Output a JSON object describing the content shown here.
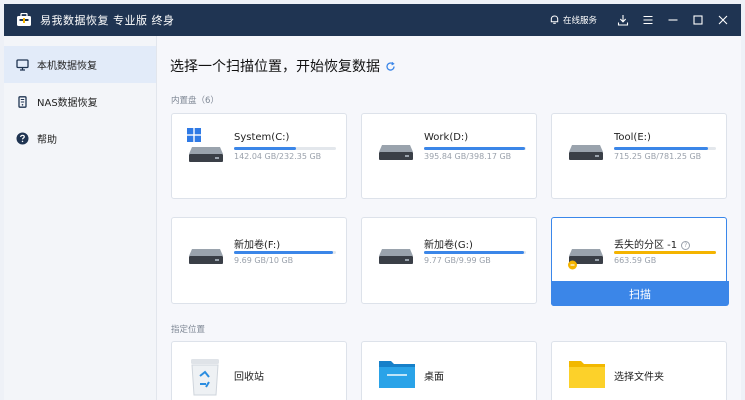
{
  "window": {
    "title": "易我数据恢复 专业版 终身",
    "online_service": "在线服务"
  },
  "sidebar": {
    "items": [
      {
        "label": "本机数据恢复",
        "icon": "computer-icon",
        "active": true
      },
      {
        "label": "NAS数据恢复",
        "icon": "nas-icon",
        "active": false
      },
      {
        "label": "帮助",
        "icon": "help-icon",
        "active": false
      }
    ]
  },
  "main": {
    "heading": "选择一个扫描位置，开始恢复数据",
    "internal_disks_label": "内置盘（6）",
    "disks": [
      {
        "name": "System(C:)",
        "size": "142.04 GB/232.35 GB",
        "usage": 0.61,
        "system": true
      },
      {
        "name": "Work(D:)",
        "size": "395.84 GB/398.17 GB",
        "usage": 0.99
      },
      {
        "name": "Tool(E:)",
        "size": "715.25 GB/781.25 GB",
        "usage": 0.92
      },
      {
        "name": "新加卷(F:)",
        "size": "9.69 GB/10 GB",
        "usage": 0.97
      },
      {
        "name": "新加卷(G:)",
        "size": "9.77 GB/9.99 GB",
        "usage": 0.98
      },
      {
        "name": "丢失的分区 -1",
        "size": "663.59 GB",
        "usage": 1.0,
        "lost": true,
        "selected": true,
        "help": "?"
      }
    ],
    "scan_button": "扫描",
    "locations_label": "指定位置",
    "locations": [
      {
        "name": "回收站",
        "icon": "recycle-bin-icon"
      },
      {
        "name": "桌面",
        "icon": "desktop-folder-icon"
      },
      {
        "name": "选择文件夹",
        "icon": "folder-icon"
      }
    ]
  },
  "colors": {
    "titlebar": "#1f3452",
    "accent": "#3b86e8",
    "lost_partition": "#f4b400"
  }
}
